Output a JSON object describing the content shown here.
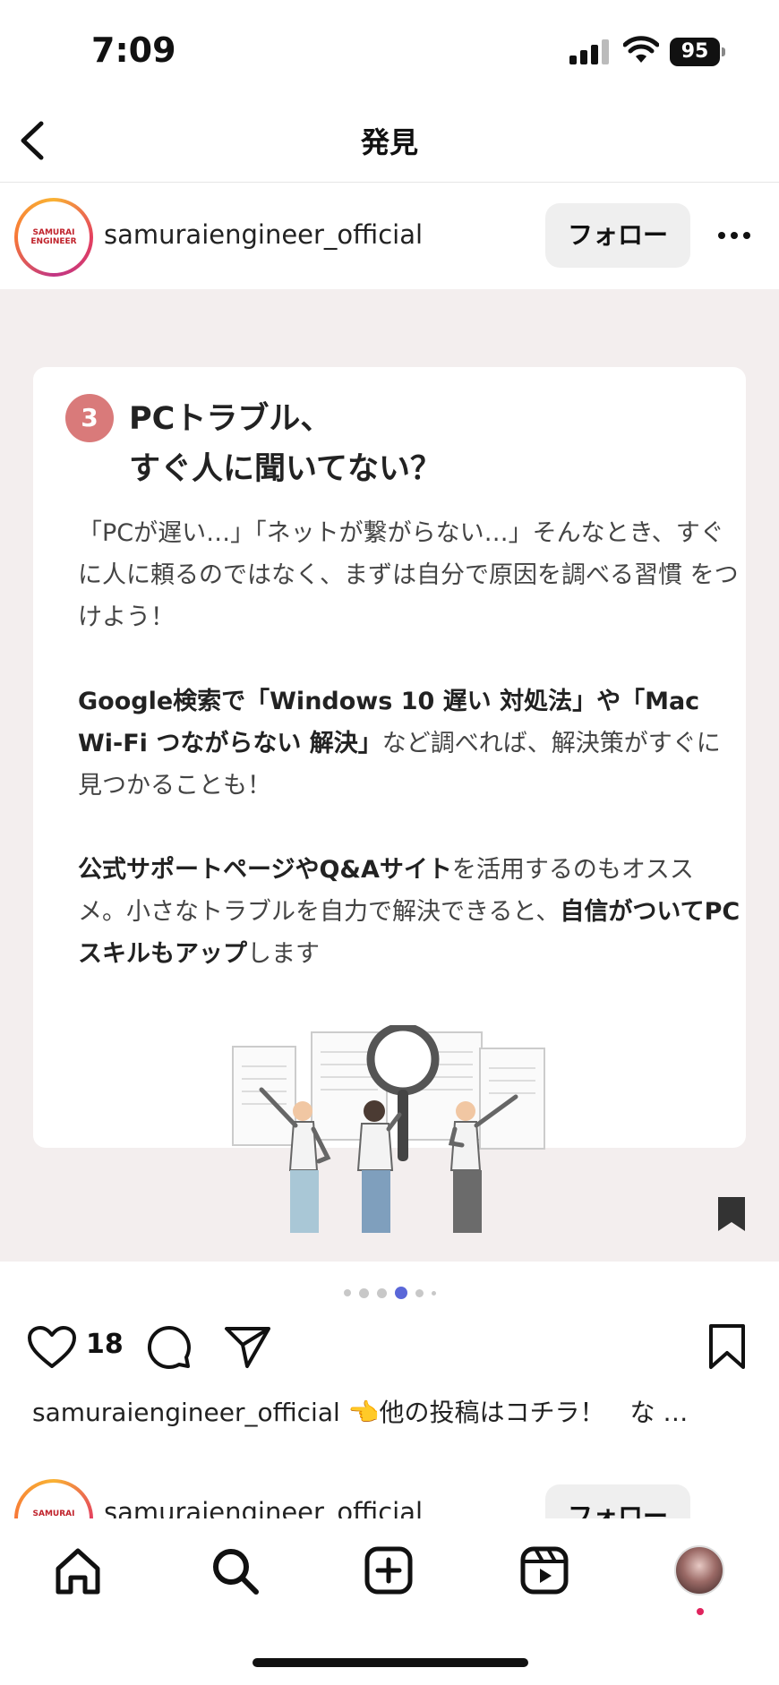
{
  "status_bar": {
    "time": "7:09",
    "battery": "95"
  },
  "nav": {
    "title": "発見"
  },
  "post": {
    "username": "samuraiengineer_official",
    "follow_label": "フォロー",
    "avatar_logo_text": "SAMURAI ENGINEER",
    "card": {
      "step_number": "3",
      "title_line1": "PCトラブル、",
      "title_line2": "すぐ人に聞いてない？",
      "p1": "「PCが遅い…」「ネットが繋がらない…」そんなとき、すぐに人に頼るのではなく、まずは自分で原因を調べる習慣 をつけよう！",
      "p2_bold": "Google検索で「Windows 10 遅い 対処法」や「Mac Wi-Fi つながらない 解決」",
      "p2_rest": "など調べれば、解決策がすぐに見つかることも！",
      "p3_bold1": "公式サポートページやQ&Aサイト",
      "p3_rest1": "を活用するのもオススメ。小さなトラブルを自力で解決できると、",
      "p3_bold2": "自信がついてPCスキルもアップ",
      "p3_rest2": "します"
    },
    "carousel": {
      "total": 6,
      "active_index": 3
    },
    "like_count": "18",
    "caption_user": "samuraiengineer_official",
    "caption_text": "👈他の投稿はコチラ！　な …"
  },
  "next_post": {
    "username": "samuraiengineer_official",
    "follow_label": "フォロー"
  },
  "colors": {
    "accent_dot": "#5a67d8",
    "badge": "#d97a7a",
    "notification": "#e0245e"
  },
  "icons": {
    "back": "chevron-left-icon",
    "more": "ellipsis-icon",
    "like": "heart-icon",
    "comment": "comment-bubble-icon",
    "share": "paper-plane-icon",
    "save": "bookmark-icon",
    "home": "home-icon",
    "search": "search-icon",
    "create": "plus-square-icon",
    "reels": "reels-icon"
  }
}
